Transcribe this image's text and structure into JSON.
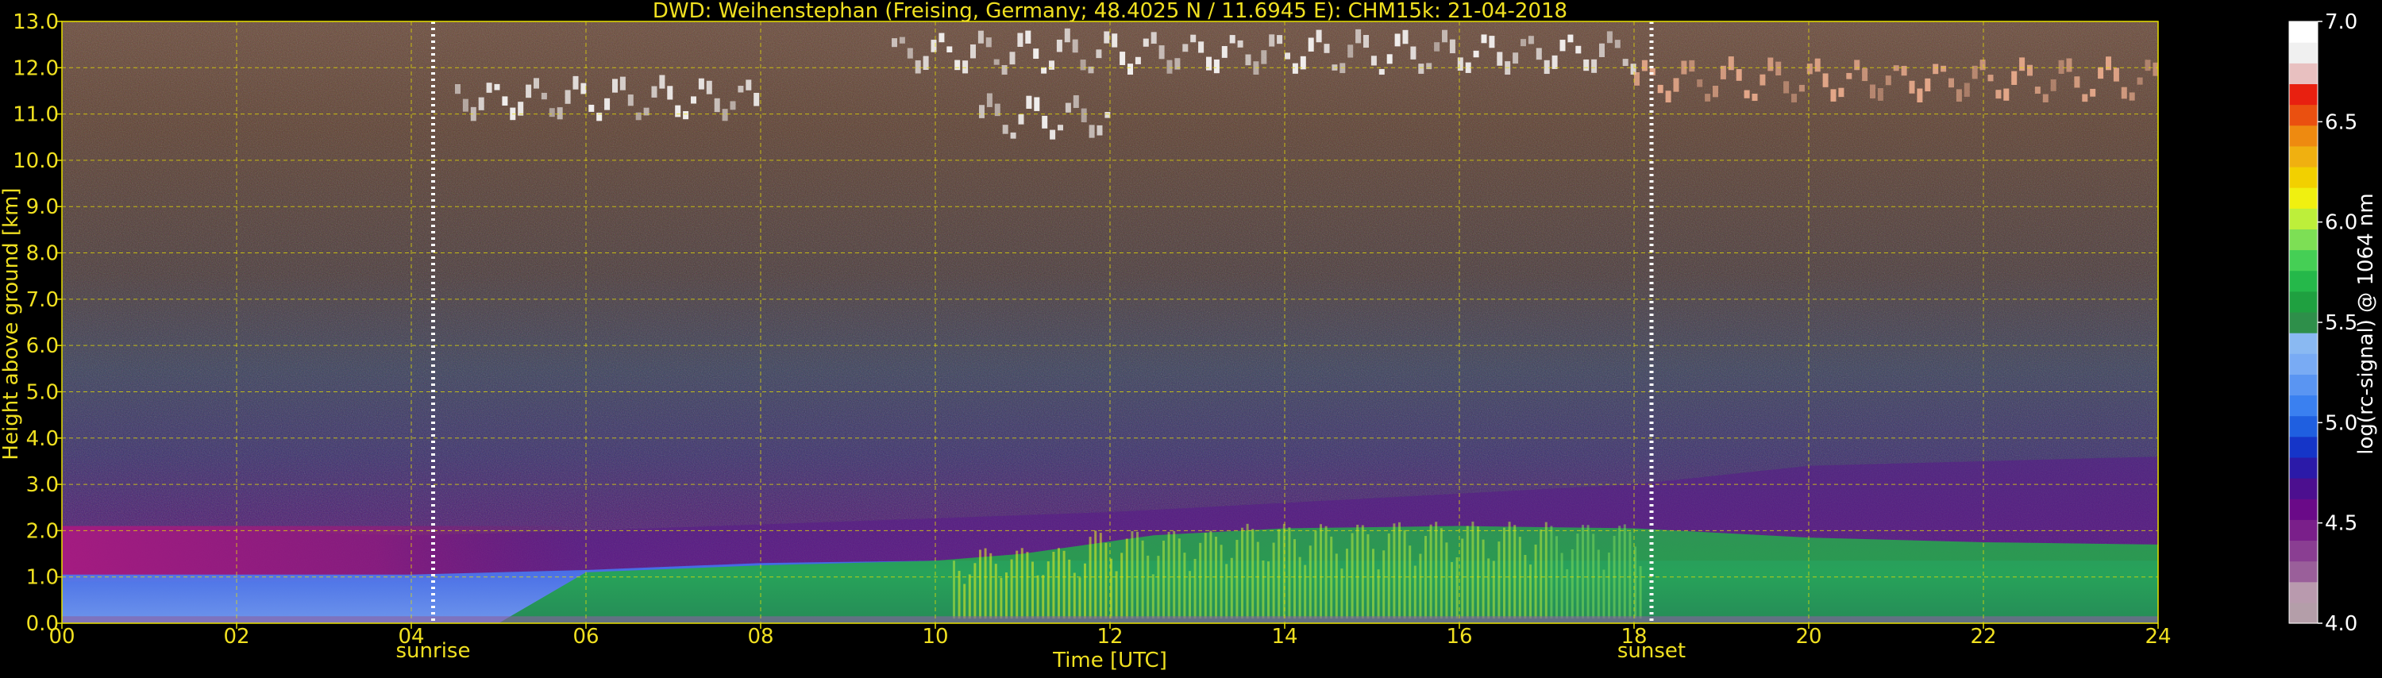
{
  "chart_data": {
    "type": "heatmap",
    "title": "DWD: Weihenstephan (Freising, Germany; 48.4025 N / 11.6945 E):    CHM15k: 21-04-2018",
    "xlabel": "Time [UTC]",
    "ylabel": "Height above ground [km]",
    "xlim": [
      0,
      24
    ],
    "ylim": [
      0,
      13
    ],
    "x_ticks": [
      "00",
      "02",
      "04",
      "06",
      "08",
      "10",
      "12",
      "14",
      "16",
      "18",
      "20",
      "22",
      "24"
    ],
    "y_ticks": [
      "0.0",
      "1.0",
      "2.0",
      "3.0",
      "4.0",
      "5.0",
      "6.0",
      "7.0",
      "8.0",
      "9.0",
      "10.0",
      "11.0",
      "12.0",
      "13.0"
    ],
    "grid": true,
    "sun_events": [
      {
        "label": "sunrise",
        "time": 4.25
      },
      {
        "label": "sunset",
        "time": 18.2
      }
    ],
    "colorbar": {
      "label": "log(rc-signal) @ 1064 nm",
      "range": [
        4.0,
        7.0
      ],
      "ticks": [
        "4.0",
        "4.5",
        "5.0",
        "5.5",
        "6.0",
        "6.5",
        "7.0"
      ],
      "colors": [
        "#b49ea9",
        "#b99aae",
        "#9a5f9a",
        "#8a3e92",
        "#7a1f8a",
        "#6a0a88",
        "#4c0f8f",
        "#2b1aa8",
        "#1535c8",
        "#1f5fe0",
        "#3a80f0",
        "#5a95f2",
        "#79abf4",
        "#8ab9f2",
        "#2e8f4a",
        "#1fa040",
        "#25b84a",
        "#45cf55",
        "#7ddf55",
        "#bdef3a",
        "#f0f010",
        "#f2d000",
        "#f0b010",
        "#ee8a10",
        "#ea5010",
        "#e82010",
        "#e8c0c0",
        "#f0f0f0",
        "#ffffff"
      ]
    },
    "layers_note_free": null,
    "boundary_layer": [
      {
        "time": 0,
        "top": 1.0
      },
      {
        "time": 4,
        "top": 1.0
      },
      {
        "time": 6,
        "top": 1.1
      },
      {
        "time": 8,
        "top": 1.25
      },
      {
        "time": 10,
        "top": 1.35
      },
      {
        "time": 11,
        "top": 1.5
      },
      {
        "time": 12.5,
        "top": 1.9
      },
      {
        "time": 14,
        "top": 2.05
      },
      {
        "time": 16,
        "top": 2.1
      },
      {
        "time": 18,
        "top": 2.05
      },
      {
        "time": 20,
        "top": 1.85
      },
      {
        "time": 22,
        "top": 1.75
      },
      {
        "time": 24,
        "top": 1.7
      }
    ],
    "residual_layer": [
      {
        "time": 0,
        "top": 2.1
      },
      {
        "time": 4,
        "top": 1.9
      },
      {
        "time": 6,
        "top": 2.0
      },
      {
        "time": 12,
        "top": 2.4
      },
      {
        "time": 18,
        "top": 3.0
      },
      {
        "time": 20,
        "top": 3.4
      },
      {
        "time": 24,
        "top": 3.6
      }
    ],
    "cirrus_clouds": [
      {
        "start": 4.5,
        "end": 8.0,
        "height": 11.2
      },
      {
        "start": 10.5,
        "end": 12.0,
        "height": 10.8
      },
      {
        "start": 9.5,
        "end": 18.0,
        "height": 12.2
      },
      {
        "start": 18.0,
        "end": 24.0,
        "height": 11.6
      }
    ]
  }
}
